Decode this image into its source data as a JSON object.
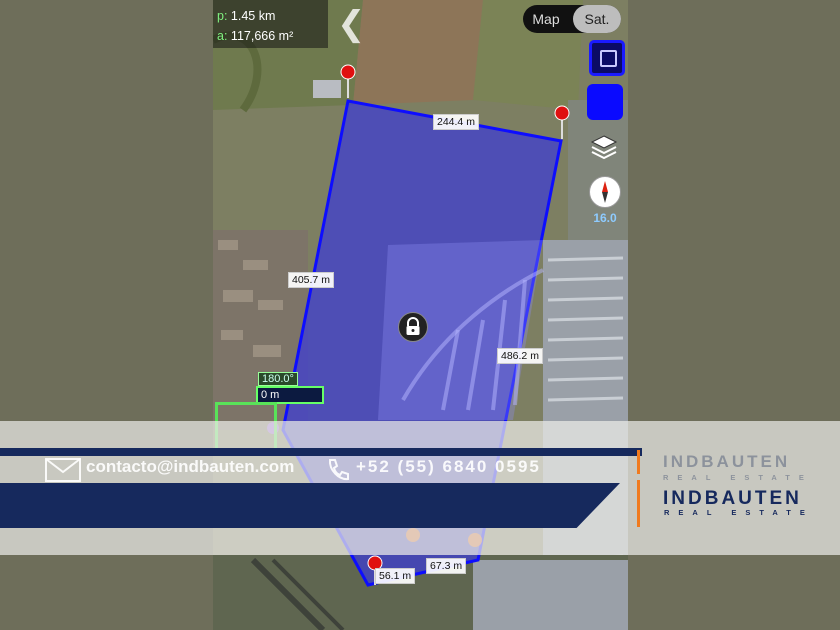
{
  "stats": {
    "perimeter_key": "p:",
    "perimeter_value": "1.45 km",
    "area_key": "a:",
    "area_value": "117,666 m²"
  },
  "map_toggle": {
    "map_label": "Map",
    "sat_label": "Sat.",
    "selected": "Sat."
  },
  "zoom_level": "16.0",
  "measurements": {
    "top_edge": "244.4 m",
    "left_edge": "405.7 m",
    "right_edge": "486.2 m",
    "bottom_left": "56.1 m",
    "bottom_right": "67.3 m"
  },
  "angle": {
    "degrees": "180.0°",
    "distance": "0 m"
  },
  "banner": {
    "email": "contacto@indbauten.com",
    "phone": "+52 (55) 6840 0595",
    "logo_text": "INDBAUTEN",
    "logo_sub": "REAL ESTATE"
  },
  "colors": {
    "polygon_fill": "#3b3bd6",
    "polygon_stroke": "#0d0dff",
    "banner_navy": "#16295d",
    "accent_orange": "#f07a1e",
    "control_blue": "#0a0aff",
    "zoom_text": "#8ecbff"
  },
  "icons": [
    "chevron-left-icon",
    "layers-icon",
    "compass-icon",
    "lock-icon",
    "mail-icon",
    "phone-icon",
    "map-pin-icon"
  ]
}
